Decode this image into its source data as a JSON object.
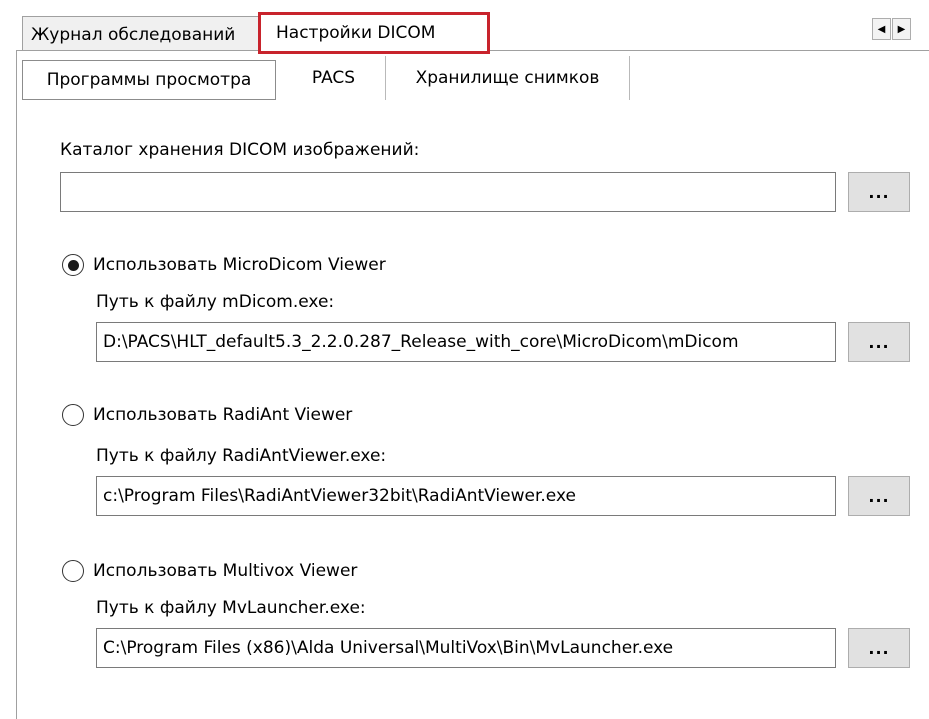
{
  "outer_tabs": [
    {
      "label": "Журнал обследований"
    },
    {
      "label": "Настройки DICOM"
    }
  ],
  "inner_tabs": [
    {
      "label": "Программы просмотра"
    },
    {
      "label": "PACS"
    },
    {
      "label": "Хранилище снимков"
    }
  ],
  "catalog": {
    "label": "Каталог хранения DICOM изображений:",
    "value": "",
    "browse_label": "..."
  },
  "viewers": [
    {
      "option_label": "Использовать MicroDicom Viewer",
      "selected": true,
      "path_label": "Путь к файлу mDicom.exe:",
      "path_value": "D:\\PACS\\HLT_default5.3_2.2.0.287_Release_with_core\\MicroDicom\\mDicom",
      "browse_label": "..."
    },
    {
      "option_label": "Использовать RadiAnt Viewer",
      "selected": false,
      "path_label": "Путь к файлу RadiAntViewer.exe:",
      "path_value": "c:\\Program Files\\RadiAntViewer32bit\\RadiAntViewer.exe",
      "browse_label": "..."
    },
    {
      "option_label": "Использовать Multivox Viewer",
      "selected": false,
      "path_label": "Путь к файлу MvLauncher.exe:",
      "path_value": "C:\\Program Files (x86)\\Alda Universal\\MultiVox\\Bin\\MvLauncher.exe",
      "browse_label": "..."
    }
  ],
  "scroll": {
    "left_icon": "◀",
    "right_icon": "▶"
  },
  "colors": {
    "active_tab_highlight": "#c8232c",
    "tab_background": "#f0f0f0",
    "button_background": "#e1e1e1"
  }
}
